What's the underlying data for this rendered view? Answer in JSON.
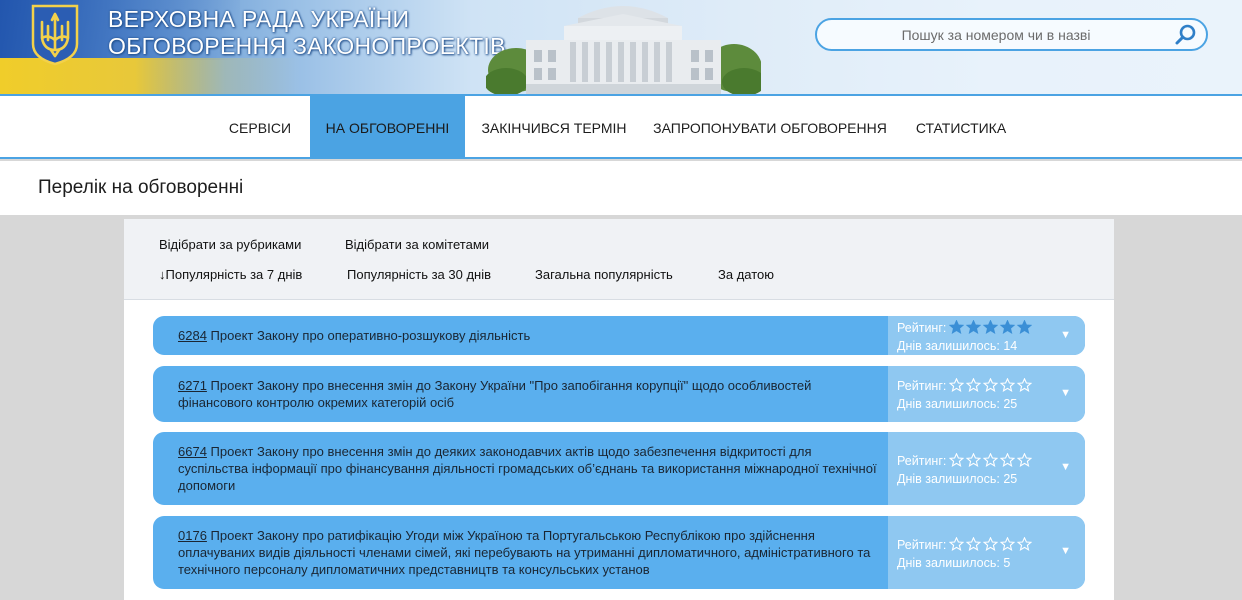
{
  "header": {
    "title_line1": "ВЕРХОВНА РАДА УКРАЇНИ",
    "title_line2": "ОБГОВОРЕННЯ ЗАКОНОПРОЕКТІВ",
    "search_placeholder": "Пошук за номером чи в назві"
  },
  "nav": [
    {
      "label": "СЕРВІСИ",
      "active": false
    },
    {
      "label": "НА ОБГОВОРЕННІ",
      "active": true
    },
    {
      "label": "ЗАКІНЧИВСЯ ТЕРМІН",
      "active": false
    },
    {
      "label": "ЗАПРОПОНУВАТИ ОБГОВОРЕННЯ",
      "active": false
    },
    {
      "label": "СТАТИСТИКА",
      "active": false
    }
  ],
  "page": {
    "title": "Перелік на обговоренні"
  },
  "filters": {
    "by_rubrics": "Відібрати за рубриками",
    "by_committees": "Відібрати за комітетами",
    "popular_7": "↓Популярність за 7 днів",
    "popular_30": "Популярність за 30 днів",
    "popular_total": "Загальна популярність",
    "by_date": "За датою"
  },
  "labels": {
    "rating": "Рейтинг:",
    "days_left": "Днів залишилось:"
  },
  "colors": {
    "accent": "#4ba3e3",
    "item_bg": "#5aafee",
    "item_side_bg": "#8fc8f1",
    "star_filled": "#3a8fd6"
  },
  "items": [
    {
      "number": "6284",
      "title": "Проект Закону про оперативно-розшукову діяльність",
      "rating": 5,
      "days": "14"
    },
    {
      "number": "6271",
      "title": "Проект Закону про внесення змін до Закону України \"Про запобігання корупції\" щодо особливостей фінансового контролю окремих категорій осіб",
      "rating": 0,
      "days": "25"
    },
    {
      "number": "6674",
      "title": "Проект Закону про внесення змін до деяких законодавчих актів щодо забезпечення відкритості для суспільства інформації про фінансування діяльності громадських об’єднань та використання міжнародної технічної допомоги",
      "rating": 0,
      "days": "25"
    },
    {
      "number": "0176",
      "title": "Проект Закону про ратифікацію Угоди між Україною та Португальською Республікою про здійснення оплачуваних видів діяльності членами сімей, які перебувають на утриманні дипломатичного, адміністративного та технічного персоналу дипломатичних представництв та консульських установ",
      "rating": 0,
      "days": "5"
    }
  ]
}
